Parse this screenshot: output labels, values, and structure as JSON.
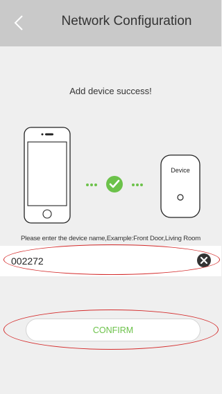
{
  "header": {
    "title": "Network Configuration",
    "back_icon": "chevron-left-icon"
  },
  "status": {
    "message": "Add device success!",
    "check_icon": "checkmark-circle-icon"
  },
  "device_illustration": {
    "device_label": "Device"
  },
  "name_form": {
    "hint": "Please enter the device name,Example:Front Door,Living Room",
    "value": "002272",
    "clear_icon": "clear-x-icon"
  },
  "confirm": {
    "label": "CONFIRM"
  },
  "colors": {
    "header_bg": "#c9c9c9",
    "page_bg": "#efefef",
    "accent_green": "#6cc24a",
    "annotation_red": "#d42b2b"
  }
}
